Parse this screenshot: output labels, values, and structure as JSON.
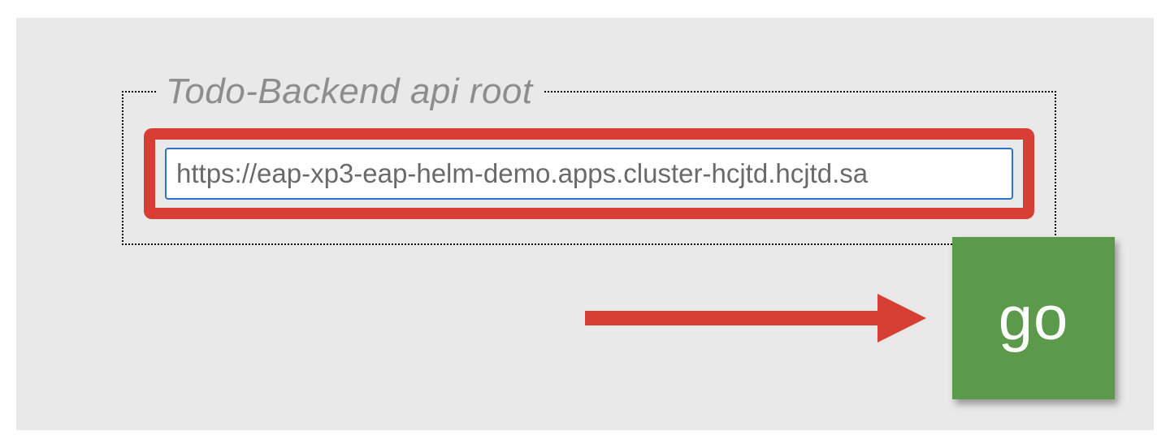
{
  "fieldset": {
    "legend": "Todo-Backend api root",
    "url_value": "https://eap-xp3-eap-helm-demo.apps.cluster-hcjtd.hcjtd.sa"
  },
  "go_button": {
    "label": "go"
  },
  "colors": {
    "highlight_red": "#d73f34",
    "button_green": "#5c9a4b",
    "input_border": "#2f6fd0",
    "background_gray": "#e9e9e9",
    "legend_gray": "#8d8d8d"
  }
}
